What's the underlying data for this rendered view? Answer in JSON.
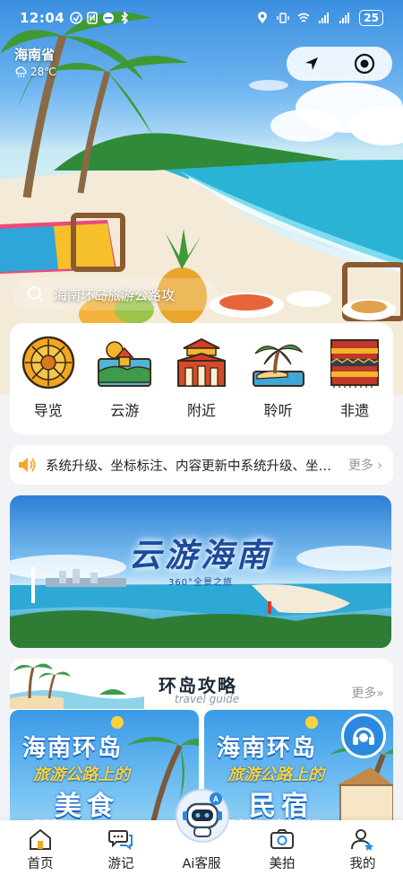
{
  "status_bar": {
    "time": "12:04",
    "battery": "25"
  },
  "location": {
    "province": "海南省",
    "temperature": "28℃"
  },
  "search": {
    "placeholder": "海南环岛旅游公路攻"
  },
  "categories": [
    {
      "label": "导览",
      "icon": "compass-guide-icon"
    },
    {
      "label": "云游",
      "icon": "pavilion-landscape-icon"
    },
    {
      "label": "附近",
      "icon": "palace-gate-icon"
    },
    {
      "label": "聆听",
      "icon": "palm-island-icon"
    },
    {
      "label": "非遗",
      "icon": "li-brocade-icon"
    }
  ],
  "notice": {
    "text": "系统升级、坐标标注、内容更新中系统升级、坐标标注",
    "more": "更多"
  },
  "banner": {
    "title": "云游海南",
    "subtitle": "360°全景之旅"
  },
  "guide": {
    "title": "环岛攻略",
    "subtitle": "travel guide",
    "more": "更多»",
    "cards": [
      {
        "line1": "海南环岛",
        "line2": "旅游公路上的",
        "line3": "美食",
        "line4": "玩海南味"
      },
      {
        "line1": "海南环岛",
        "line2": "旅游公路上的",
        "line3": "民宿",
        "line4": "玩海南味·慢享海岛时光"
      }
    ]
  },
  "tabbar": [
    {
      "label": "首页",
      "icon": "home-icon"
    },
    {
      "label": "游记",
      "icon": "chat-bubbles-icon"
    },
    {
      "label": "Ai客服",
      "icon": "robot-icon"
    },
    {
      "label": "美拍",
      "icon": "camera-icon"
    },
    {
      "label": "我的",
      "icon": "user-icon"
    }
  ],
  "colors": {
    "accent": "#2a88df",
    "notice_icon": "#f5a623",
    "sea": "#2bb3d6"
  }
}
